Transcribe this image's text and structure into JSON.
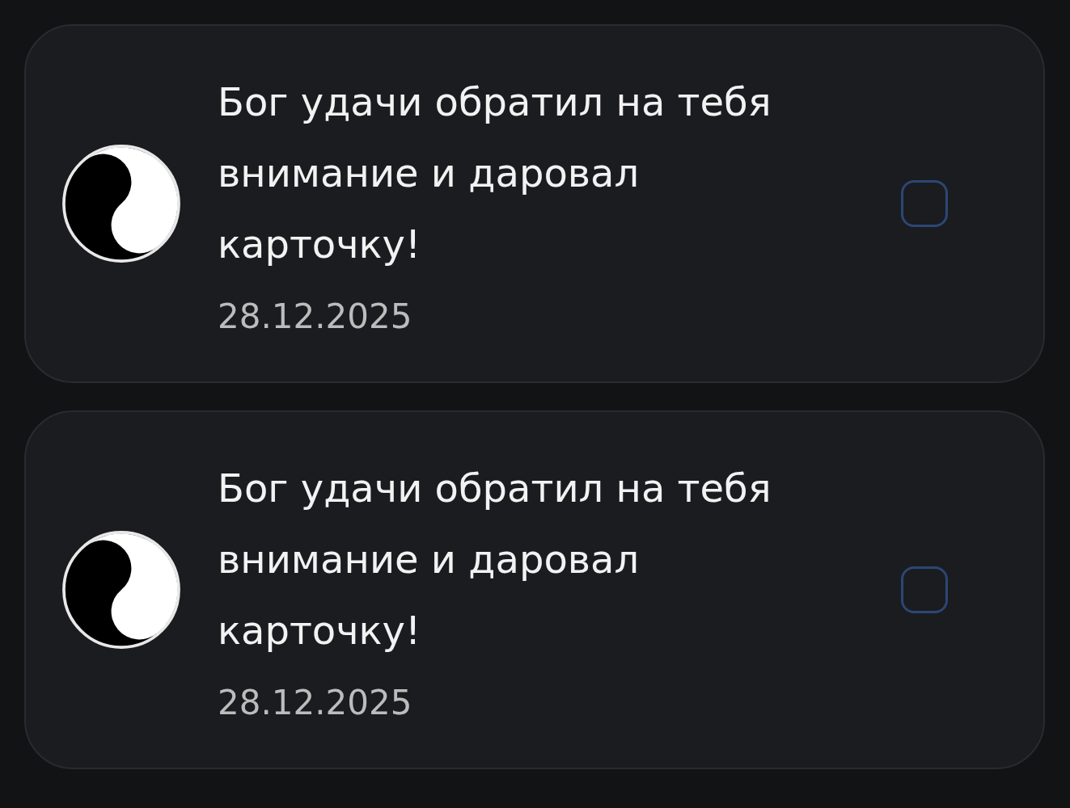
{
  "notifications": [
    {
      "message": "Бог удачи обратил на тебя внимание и даровал карточку!",
      "date": "28.12.2025",
      "checked": false
    },
    {
      "message": "Бог удачи обратил на тебя внимание и даровал карточку!",
      "date": "28.12.2025",
      "checked": false
    }
  ]
}
